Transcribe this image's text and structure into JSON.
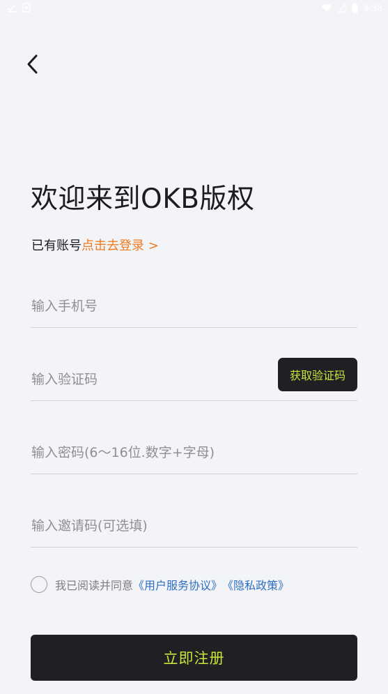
{
  "status_bar": {
    "time": "9:38",
    "left_icons": [
      "check-notification-icon",
      "app-notification-icon"
    ],
    "right_icons": [
      "wifi-icon",
      "signal-icon",
      "battery-icon"
    ]
  },
  "header": {
    "back_icon": "chevron-left-icon"
  },
  "welcome": {
    "title": "欢迎来到OKB版权"
  },
  "login": {
    "prefix": "已有账号",
    "link": "点击去登录 >"
  },
  "form": {
    "phone": {
      "value": "",
      "placeholder": "输入手机号"
    },
    "code": {
      "value": "",
      "placeholder": "输入验证码",
      "button": "获取验证码"
    },
    "password": {
      "value": "",
      "placeholder": "输入密码(6～16位.数字+字母)"
    },
    "invite": {
      "value": "",
      "placeholder": "输入邀请码(可选填)"
    }
  },
  "agreement": {
    "checked": false,
    "text": "我已阅读并同意",
    "terms": "《用户服务协议》",
    "privacy": "《隐私政策》"
  },
  "register": {
    "label": "立即注册"
  },
  "colors": {
    "background": "#f3f4f8",
    "accent_orange": "#f07a1e",
    "button_dark": "#1f2024",
    "button_text": "#cde23a",
    "link_blue": "#2c6fc0"
  }
}
